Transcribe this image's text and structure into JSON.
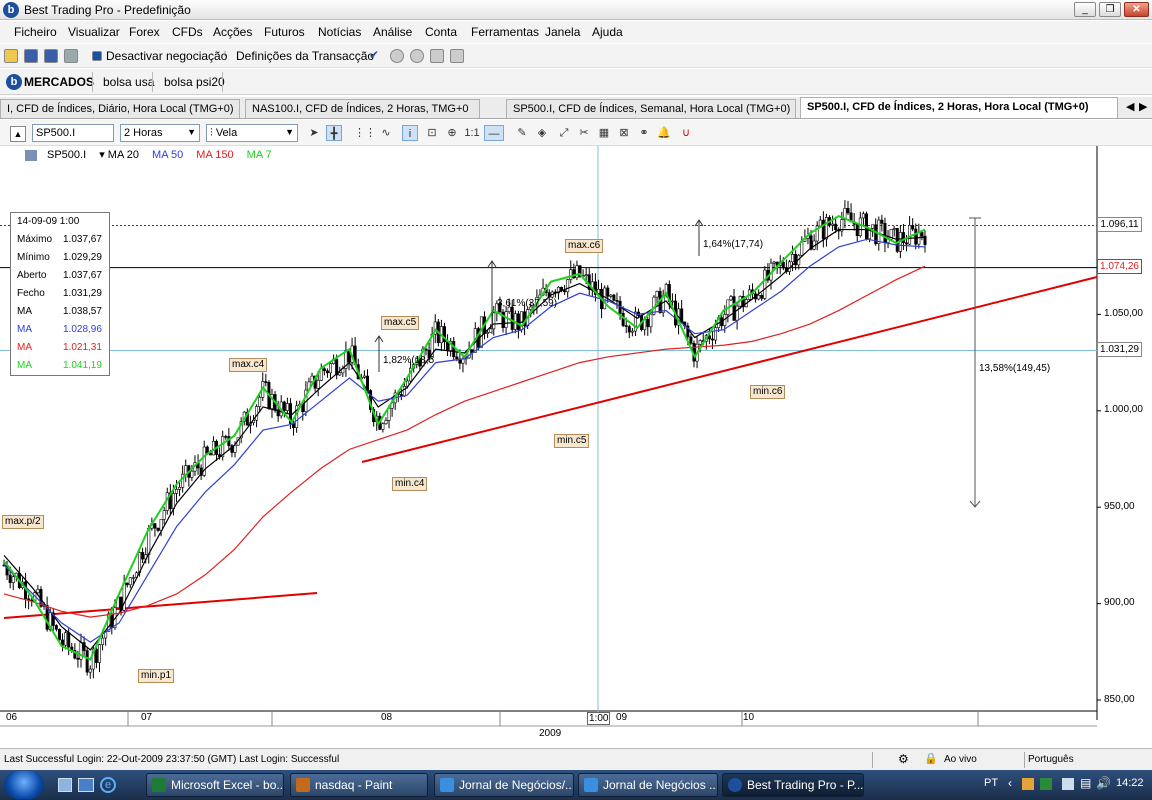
{
  "window": {
    "title": "Best Trading Pro - Predefinição",
    "app_icon": "b"
  },
  "menu": [
    "Ficheiro",
    "Visualizar",
    "Forex",
    "CFDs",
    "Acções",
    "Futuros",
    "Notícias",
    "Análise",
    "Conta",
    "Ferramentas",
    "Janela",
    "Ajuda"
  ],
  "toolbar": {
    "deactivate_label": "Desactivar negociação",
    "settings_label": "Definições da Transacção"
  },
  "markets": {
    "main": "MERCADOS",
    "tabs": [
      "bolsa usa",
      "bolsa psi20"
    ]
  },
  "chart_tabs": [
    {
      "label": "I, CFD de Índices, Diário, Hora Local (TMG+0)",
      "active": false
    },
    {
      "label": "NAS100.I, CFD de Índices, 2 Horas, TMG+0",
      "active": false
    },
    {
      "label": "SP500.I, CFD de Índices, Semanal, Hora Local (TMG+0)",
      "active": false
    },
    {
      "label": "SP500.I, CFD de Índices, 2 Horas, Hora Local (TMG+0)",
      "active": true
    }
  ],
  "chart_toolbar": {
    "symbol": "SP500.I",
    "interval": "2 Horas",
    "style": "Vela"
  },
  "legend": {
    "symbol": "SP500.I",
    "ma20": "MA 20",
    "ma50": "MA 50",
    "ma150": "MA 150",
    "ma7": "MA 7"
  },
  "colors": {
    "ma20": "#000000",
    "ma50": "#2f3fd6",
    "ma150": "#e02020",
    "ma7": "#1fcf1f",
    "trendline": "#e00000"
  },
  "infobox": {
    "datetime": "14-09-09   1:00",
    "rows": [
      {
        "k": "Máximo",
        "v": "1.037,67"
      },
      {
        "k": "Mínimo",
        "v": "1.029,29"
      },
      {
        "k": "Aberto",
        "v": "1.037,67"
      },
      {
        "k": "Fecho",
        "v": "1.031,29"
      },
      {
        "k": "MA",
        "v": "1.038,57"
      },
      {
        "k": "MA",
        "v": "1.028,96"
      },
      {
        "k": "MA",
        "v": "1.021,31"
      },
      {
        "k": "MA",
        "v": "1.041,19"
      }
    ]
  },
  "annotations": {
    "max_p2": "max.p/2",
    "min_p1": "min.p1",
    "max_c4": "max.c4",
    "min_c4": "min.c4",
    "max_c5": "max.c5",
    "min_c5": "min.c5",
    "max_c6": "max.c6",
    "min_c6": "min.c6",
    "pct1": "1,82%(18,5",
    "pct2": "3,61%(37,59)",
    "pct3": "1,64%(17,74)",
    "pct4": "13,58%(149,45)"
  },
  "price_tags": {
    "top": "1.096,11",
    "mid": "1.074,26",
    "cursor": "1.031,29"
  },
  "chart_data": {
    "type": "line",
    "title": "SP500.I",
    "ylim": [
      840,
      1110
    ],
    "y_ticks": [
      "1.100,00",
      "1.050,00",
      "1.000,00",
      "950,00",
      "900,00",
      "850,00"
    ],
    "x_ticks": [
      "06",
      "07",
      "08",
      "1:00",
      "09",
      "10"
    ],
    "x_year": "2009",
    "series": [
      {
        "name": "SP500.I",
        "values": [
          920,
          905,
          880,
          870,
          900,
          935,
          960,
          975,
          985,
          1010,
          995,
          1020,
          1030,
          995,
          1015,
          1040,
          1030,
          1050,
          1045,
          1065,
          1070,
          1055,
          1045,
          1060,
          1030,
          1050,
          1060,
          1075,
          1090,
          1100,
          1095,
          1088,
          1093
        ]
      },
      {
        "name": "MA 20",
        "values": [
          925,
          908,
          888,
          876,
          895,
          925,
          952,
          970,
          982,
          1002,
          998,
          1012,
          1025,
          1002,
          1012,
          1032,
          1030,
          1045,
          1046,
          1060,
          1066,
          1058,
          1048,
          1057,
          1038,
          1047,
          1058,
          1070,
          1084,
          1094,
          1094,
          1089,
          1090
        ]
      },
      {
        "name": "MA 50",
        "values": [
          920,
          905,
          890,
          880,
          890,
          915,
          940,
          958,
          972,
          990,
          993,
          1005,
          1017,
          1005,
          1008,
          1025,
          1027,
          1038,
          1042,
          1054,
          1061,
          1057,
          1050,
          1052,
          1040,
          1042,
          1052,
          1062,
          1075,
          1085,
          1089,
          1086,
          1085
        ]
      },
      {
        "name": "MA 150",
        "values": [
          905,
          901,
          896,
          893,
          895,
          899,
          905,
          915,
          928,
          945,
          958,
          970,
          980,
          985,
          990,
          998,
          1005,
          1010,
          1015,
          1020,
          1025,
          1028,
          1030,
          1032,
          1033,
          1034,
          1036,
          1040,
          1045,
          1052,
          1060,
          1068,
          1075
        ]
      },
      {
        "name": "MA 7",
        "values": [
          922,
          903,
          878,
          871,
          905,
          938,
          962,
          977,
          987,
          1012,
          994,
          1022,
          1032,
          993,
          1017,
          1042,
          1028,
          1052,
          1044,
          1067,
          1071,
          1054,
          1043,
          1061,
          1028,
          1052,
          1061,
          1077,
          1092,
          1101,
          1095,
          1087,
          1094
        ]
      }
    ]
  },
  "status": {
    "login": "Last Successful Login: 22-Out-2009 23:37:50 (GMT)   Last Login: Successful",
    "live": "Ao vivo",
    "language": "Português"
  },
  "taskbar": {
    "items": [
      "Microsoft Excel - bo...",
      "nasdaq - Paint",
      "Jornal de Negócios/...",
      "Jornal de Negócios ...",
      "Best Trading Pro - P..."
    ],
    "lang": "PT",
    "clock": "14:22"
  }
}
